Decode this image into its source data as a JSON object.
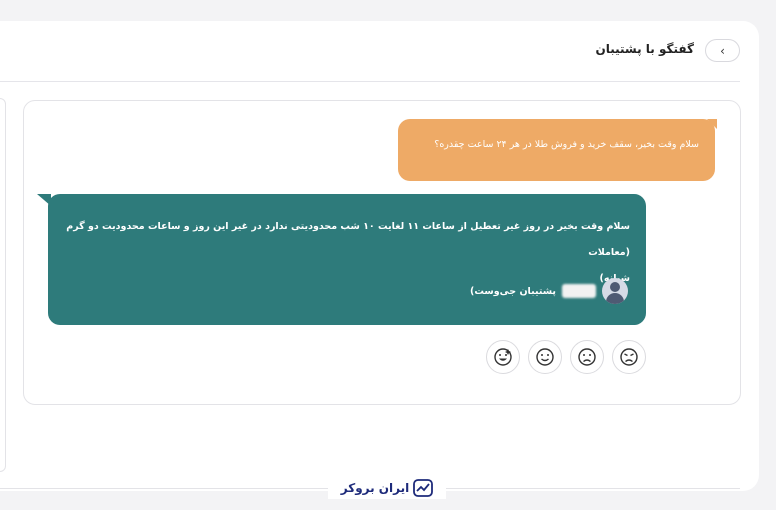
{
  "header": {
    "title": "گفتگو با پشتیبان",
    "back_icon": "‹"
  },
  "messages": {
    "user": "سلام وقت بخیر، سقف خرید و فروش طلا در هر ۲۴ ساعت چقدره؟",
    "bot_line1": "سلام وقت بخیر در روز غیر تعطیل از ساعات ۱۱ لغایت ۱۰ شب محدودیتی ندارد در غیر این روز و ساعات محدودیت دو گرم (معاملات",
    "bot_line2": "شبانه)",
    "agent_name": "پشتیبان جی‌وست)"
  },
  "ratings": [
    "very-dissatisfied-icon",
    "dissatisfied-icon",
    "satisfied-icon",
    "very-satisfied-icon"
  ],
  "footer": {
    "brand": "ایران بروکر"
  },
  "colors": {
    "user_bubble": "#eeaa66",
    "bot_bubble": "#2e7b7b",
    "brand": "#1d2a7a"
  }
}
